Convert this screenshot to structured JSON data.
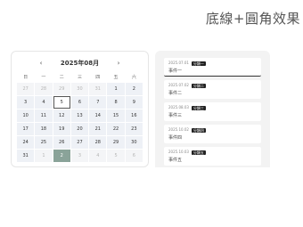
{
  "page_title": "底線+圓角效果",
  "calendar": {
    "prev_label": "‹",
    "next_label": "›",
    "title": "2025年08月",
    "weekdays": [
      "日",
      "一",
      "二",
      "三",
      "四",
      "五",
      "六"
    ],
    "days": [
      {
        "label": "27",
        "state": "other"
      },
      {
        "label": "28",
        "state": "other"
      },
      {
        "label": "29",
        "state": "other"
      },
      {
        "label": "30",
        "state": "other"
      },
      {
        "label": "31",
        "state": "other"
      },
      {
        "label": "1",
        "state": "current"
      },
      {
        "label": "2",
        "state": "current"
      },
      {
        "label": "3",
        "state": "current"
      },
      {
        "label": "4",
        "state": "current"
      },
      {
        "label": "5",
        "state": "today"
      },
      {
        "label": "6",
        "state": "current"
      },
      {
        "label": "7",
        "state": "current"
      },
      {
        "label": "8",
        "state": "current"
      },
      {
        "label": "9",
        "state": "current"
      },
      {
        "label": "10",
        "state": "current"
      },
      {
        "label": "11",
        "state": "current"
      },
      {
        "label": "12",
        "state": "current"
      },
      {
        "label": "13",
        "state": "current"
      },
      {
        "label": "14",
        "state": "current"
      },
      {
        "label": "15",
        "state": "current"
      },
      {
        "label": "16",
        "state": "current"
      },
      {
        "label": "17",
        "state": "current"
      },
      {
        "label": "18",
        "state": "current"
      },
      {
        "label": "19",
        "state": "current"
      },
      {
        "label": "20",
        "state": "current"
      },
      {
        "label": "21",
        "state": "current"
      },
      {
        "label": "22",
        "state": "current"
      },
      {
        "label": "23",
        "state": "current"
      },
      {
        "label": "24",
        "state": "current"
      },
      {
        "label": "25",
        "state": "current"
      },
      {
        "label": "26",
        "state": "current"
      },
      {
        "label": "27",
        "state": "current"
      },
      {
        "label": "28",
        "state": "current"
      },
      {
        "label": "29",
        "state": "current"
      },
      {
        "label": "30",
        "state": "current"
      },
      {
        "label": "31",
        "state": "current"
      },
      {
        "label": "1",
        "state": "other"
      },
      {
        "label": "2",
        "state": "selected"
      },
      {
        "label": "3",
        "state": "other"
      },
      {
        "label": "4",
        "state": "other"
      },
      {
        "label": "5",
        "state": "other"
      },
      {
        "label": "6",
        "state": "other"
      }
    ],
    "colors": {
      "cell": "#eef1f6",
      "selected": "#8aa399"
    }
  },
  "events": [
    {
      "date": "2025.07.01",
      "badge": "分類一",
      "title": "事件一",
      "active": true
    },
    {
      "date": "2025.07.02",
      "badge": "分類二",
      "title": "事件二",
      "active": false
    },
    {
      "date": "2025.08.03",
      "badge": "分類三",
      "title": "事件三",
      "active": false
    },
    {
      "date": "2025.10.02",
      "badge": "分類四",
      "title": "事件四",
      "active": false
    },
    {
      "date": "2025.10.03",
      "badge": "分類五",
      "title": "事件五",
      "active": false
    }
  ]
}
